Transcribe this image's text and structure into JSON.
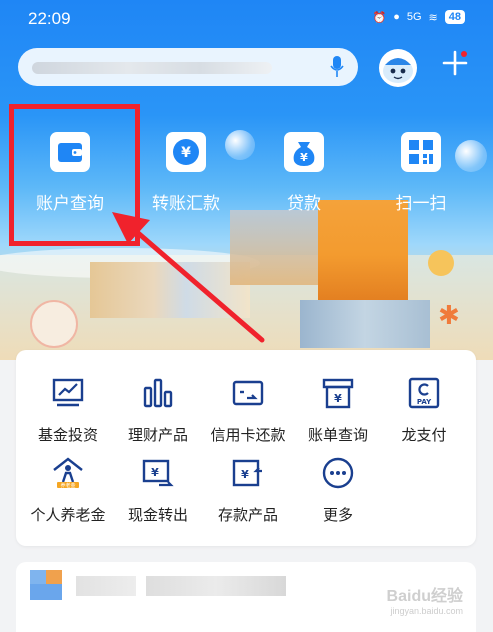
{
  "status_bar": {
    "time": "22:09",
    "network": "5G",
    "battery": "48"
  },
  "quick_actions": [
    {
      "label": "账户查询",
      "icon": "wallet-icon"
    },
    {
      "label": "转账汇款",
      "icon": "transfer-icon"
    },
    {
      "label": "贷款",
      "icon": "money-bag-icon"
    },
    {
      "label": "扫一扫",
      "icon": "scan-icon"
    }
  ],
  "services": [
    {
      "label": "基金投资",
      "icon": "fund-chart-icon"
    },
    {
      "label": "理财产品",
      "icon": "bar-chart-icon"
    },
    {
      "label": "信用卡还款",
      "icon": "credit-card-icon"
    },
    {
      "label": "账单查询",
      "icon": "bill-icon"
    },
    {
      "label": "龙支付",
      "icon": "long-pay-icon"
    },
    {
      "label": "个人养老金",
      "icon": "pension-icon"
    },
    {
      "label": "现金转出",
      "icon": "cash-out-icon"
    },
    {
      "label": "存款产品",
      "icon": "deposit-icon"
    },
    {
      "label": "更多",
      "icon": "more-icon"
    }
  ],
  "pay_badge": "PAY",
  "pension_badge": "养老金",
  "watermark": {
    "brand": "Baidu经验",
    "url": "jingyan.baidu.com"
  },
  "colors": {
    "primary": "#1f86f5",
    "highlight_red": "#f0222c",
    "icon_blue": "#1a3f8f"
  }
}
